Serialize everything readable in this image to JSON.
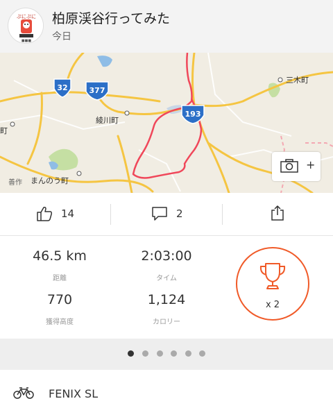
{
  "activity": {
    "title": "柏原渓谷行ってみた",
    "date": "今日"
  },
  "map": {
    "place_labels": {
      "mikicho": "三木町",
      "ayagawacho": "綾川町",
      "mannocho": "まんのう町",
      "left_town": "町",
      "zosaku": "善作"
    },
    "route_shields": [
      "32",
      "377",
      "193"
    ],
    "route_color": "#f0475a"
  },
  "camera_button": {
    "icon": "camera-icon",
    "plus": "+"
  },
  "social": {
    "kudos_count": "14",
    "comment_count": "2"
  },
  "stats": {
    "distance": {
      "value": "46.5 km",
      "label": "距離"
    },
    "time": {
      "value": "2:03:00",
      "label": "タイム"
    },
    "elevation": {
      "value": "770",
      "label": "獲得高度"
    },
    "calories": {
      "value": "1,124",
      "label": "カロリー"
    },
    "achievements": {
      "count": "x 2"
    }
  },
  "pager": {
    "total": 6,
    "active": 0
  },
  "gear": {
    "name": "FENIX SL"
  },
  "colors": {
    "accent": "#f05a28",
    "header_bg": "#f3f3f3",
    "map_road": "#f5c542",
    "map_water": "#7fb3e0"
  }
}
